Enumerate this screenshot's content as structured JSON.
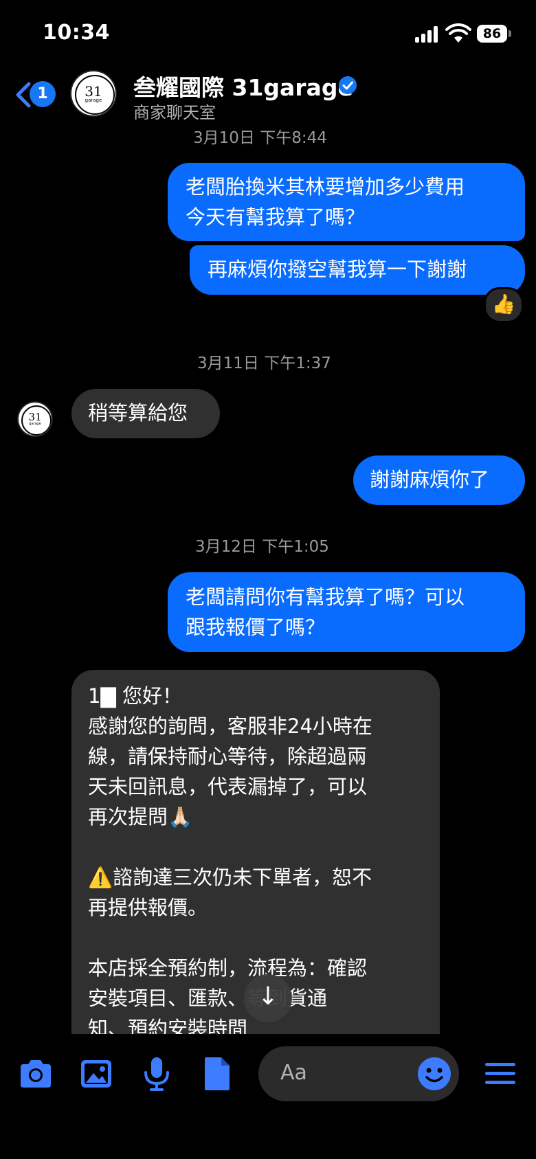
{
  "status_bar": {
    "time": "10:34",
    "battery": "86"
  },
  "header": {
    "back_badge": "1",
    "title": "叁耀國際 31garage",
    "subtitle": "商家聊天室",
    "avatar_text": "31",
    "avatar_subtext": "garage"
  },
  "messages": [
    {
      "type": "timestamp",
      "text": "3月10日 下午8:44"
    },
    {
      "type": "outgoing",
      "lines": [
        "老闆胎換米其林要增加多少費用",
        "今天有幫我算了嗎？"
      ]
    },
    {
      "type": "outgoing",
      "text": "再麻煩你撥空幫我算一下謝謝",
      "reaction": "👍"
    },
    {
      "type": "timestamp",
      "text": "3月11日 下午1:37"
    },
    {
      "type": "incoming",
      "text": "稍等算給您"
    },
    {
      "type": "outgoing",
      "text": "謝謝麻煩你了"
    },
    {
      "type": "timestamp",
      "text": "3月12日 下午1:05"
    },
    {
      "type": "outgoing",
      "lines": [
        "老闆請問你有幫我算了嗎？可以",
        "跟我報價了嗎？"
      ]
    },
    {
      "type": "incoming",
      "text": "1▇ 您好！\n感謝您的詢問，客服非24小時在\n線，請保持耐心等待，除超過兩\n天未回訊息，代表漏掉了，可以\n再次提問🙏🏻\n\n⚠️諮詢達三次仍未下單者，恕不\n再提供報價。\n\n本店採全預約制，流程為：確認\n安裝項目、匯款、等到貨通\n知、預約安裝時間"
    }
  ],
  "composer": {
    "placeholder": "Aa",
    "icons": [
      "camera-icon",
      "image-icon",
      "microphone-icon",
      "file-icon",
      "emoji-icon",
      "menu-icon"
    ]
  },
  "colors": {
    "outgoing": "#0a6cff",
    "incoming": "#303030",
    "accent": "#3d7bff",
    "background": "#000000"
  }
}
